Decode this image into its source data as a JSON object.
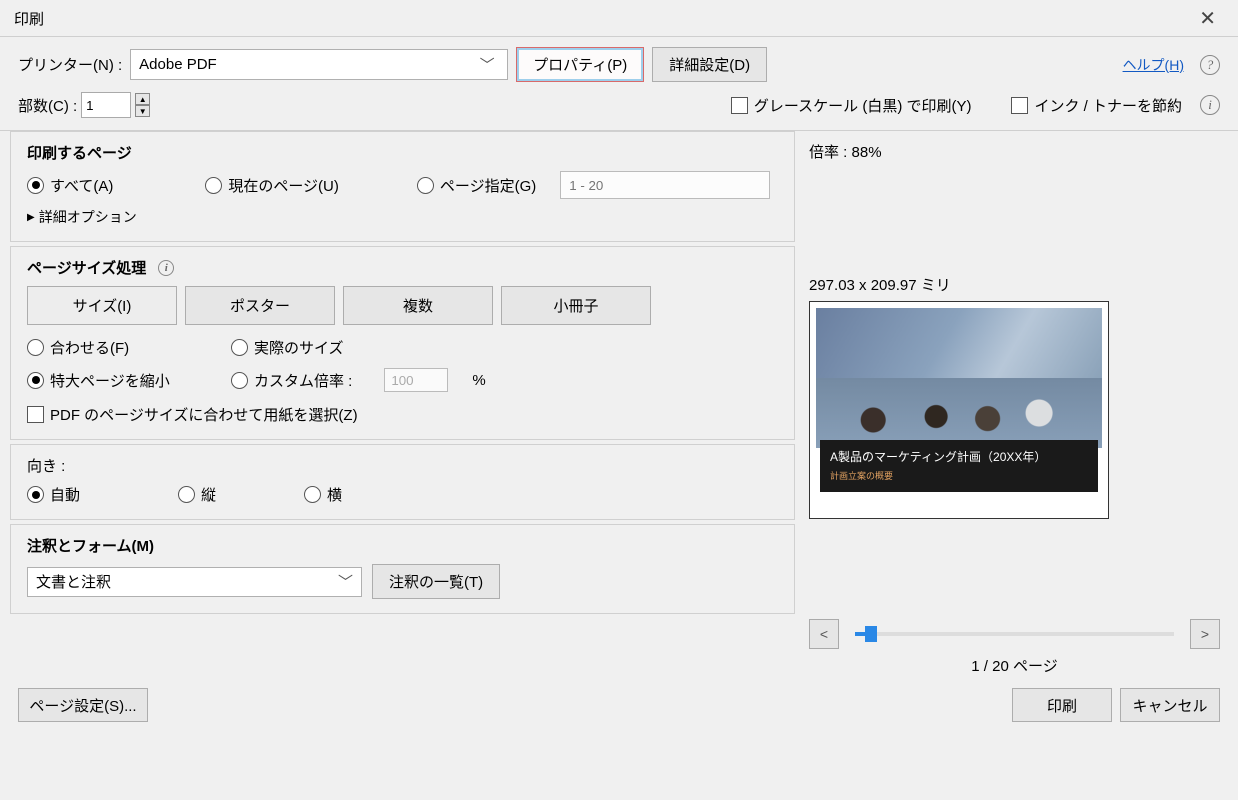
{
  "title": "印刷",
  "printer": {
    "label": "プリンター(N) :",
    "value": "Adobe PDF",
    "properties_btn": "プロパティ(P)",
    "advanced_btn": "詳細設定(D)",
    "help": "ヘルプ(H)"
  },
  "copies": {
    "label": "部数(C) :",
    "value": "1"
  },
  "grayscale": "グレースケール (白黒) で印刷(Y)",
  "saveink": "インク / トナーを節約",
  "pages": {
    "heading": "印刷するページ",
    "all": "すべて(A)",
    "current": "現在のページ(U)",
    "range": "ページ指定(G)",
    "range_hint": "1 - 20",
    "detail": "詳細オプション"
  },
  "size": {
    "heading": "ページサイズ処理",
    "btn_size": "サイズ(I)",
    "btn_poster": "ポスター",
    "btn_multi": "複数",
    "btn_booklet": "小冊子",
    "fit": "合わせる(F)",
    "actual": "実際のサイズ",
    "shrink": "特大ページを縮小",
    "custom": "カスタム倍率 :",
    "custom_val": "100",
    "pct": "%",
    "pdf_paper": "PDF のページサイズに合わせて用紙を選択(Z)"
  },
  "orient": {
    "heading": "向き :",
    "auto": "自動",
    "portrait": "縦",
    "landscape": "横"
  },
  "forms": {
    "heading": "注釈とフォーム(M)",
    "selected": "文書と注釈",
    "list_btn": "注釈の一覧(T)"
  },
  "preview": {
    "zoom_label": "倍率 :",
    "zoom_value": "88%",
    "dimensions": "297.03 x 209.97 ミリ",
    "slide_title": "A製品のマーケティング計画（20XX年）",
    "slide_sub": "計画立案の概要",
    "prev": "<",
    "next": ">",
    "page_counter": "1 / 20 ページ"
  },
  "bottom": {
    "page_setup": "ページ設定(S)...",
    "print": "印刷",
    "cancel": "キャンセル"
  }
}
